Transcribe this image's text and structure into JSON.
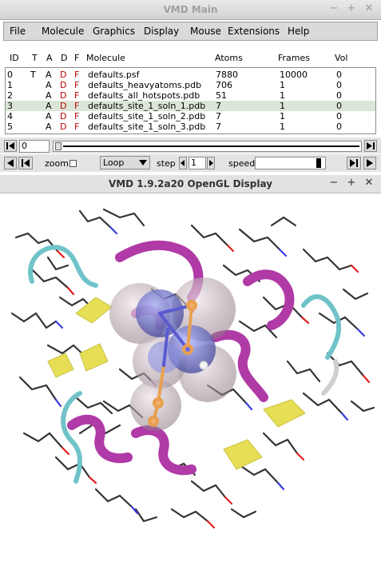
{
  "main_window": {
    "title": "VMD Main",
    "buttons": [
      "−",
      "+",
      "✕"
    ]
  },
  "menu": [
    "File",
    "Molecule",
    "Graphics",
    "Display",
    "Mouse",
    "Extensions",
    "Help"
  ],
  "columns": [
    "ID",
    "T",
    "A",
    "D",
    "F",
    "Molecule",
    "Atoms",
    "Frames",
    "Vol"
  ],
  "molecules": [
    {
      "id": "0",
      "t": "T",
      "a": "A",
      "d": "D",
      "f": "F",
      "name": "defaults.psf",
      "atoms": "7880",
      "frames": "10000",
      "vol": "0"
    },
    {
      "id": "1",
      "t": "",
      "a": "A",
      "d": "D",
      "f": "F",
      "name": "defaults_heavyatoms.pdb",
      "atoms": "706",
      "frames": "1",
      "vol": "0"
    },
    {
      "id": "2",
      "t": "",
      "a": "A",
      "d": "D",
      "f": "F",
      "name": "defaults_all_hotspots.pdb",
      "atoms": "51",
      "frames": "1",
      "vol": "0"
    },
    {
      "id": "3",
      "t": "",
      "a": "A",
      "d": "D",
      "f": "F",
      "name": "defaults_site_1_soln_1.pdb",
      "atoms": "7",
      "frames": "1",
      "vol": "0"
    },
    {
      "id": "4",
      "t": "",
      "a": "A",
      "d": "D",
      "f": "F",
      "name": "defaults_site_1_soln_2.pdb",
      "atoms": "7",
      "frames": "1",
      "vol": "0"
    },
    {
      "id": "5",
      "t": "",
      "a": "A",
      "d": "D",
      "f": "F",
      "name": "defaults_site_1_soln_3.pdb",
      "atoms": "7",
      "frames": "1",
      "vol": "0"
    }
  ],
  "selected_row": 3,
  "animation": {
    "frame_value": "0",
    "zoom_label": "zoom",
    "loop_mode": "Loop",
    "step_label": "step",
    "step_value": "1",
    "speed_label": "speed",
    "speed_fraction": 0.95
  },
  "gl_window": {
    "title": "VMD 1.9.2a20 OpenGL Display",
    "buttons": [
      "−",
      "+",
      "✕"
    ]
  },
  "colors": {
    "selected_row": "#dbe6d6",
    "helix": "#b03aa6",
    "sheet": "#e6df55",
    "coil": "#6fc3c9",
    "sphere": "#a99aa2"
  }
}
